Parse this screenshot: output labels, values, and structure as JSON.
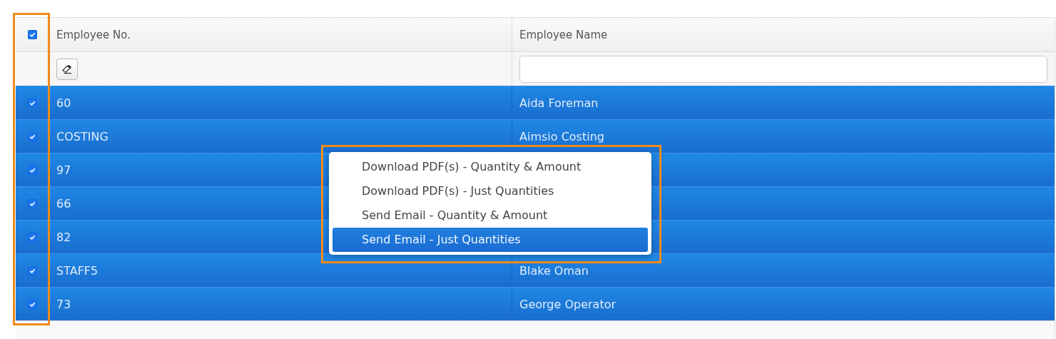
{
  "table": {
    "select_all": {
      "checked": true
    },
    "columns": [
      "Employee No.",
      "Employee Name"
    ],
    "rows": [
      {
        "number": "60",
        "name": "Aida Foreman",
        "checked": true,
        "selected": true
      },
      {
        "number": "COSTING",
        "name": "Aimsio Costing",
        "checked": true,
        "selected": true
      },
      {
        "number": "97",
        "checked": true,
        "selected": true
      },
      {
        "number": "66",
        "checked": true,
        "selected": true
      },
      {
        "number": "82",
        "checked": true,
        "selected": true
      },
      {
        "number": "STAFF5",
        "name": "Blake Oman",
        "checked": true,
        "selected": true
      },
      {
        "number": "73",
        "name": "George Operator",
        "checked": true,
        "selected": true
      }
    ]
  },
  "context_menu": {
    "items": [
      {
        "label": "Download PDF(s) - Quantity & Amount",
        "selected": false
      },
      {
        "label": "Download PDF(s) - Just Quantities",
        "selected": false
      },
      {
        "label": "Send Email - Quantity & Amount",
        "selected": false
      },
      {
        "label": "Send Email - Just Quantities",
        "selected": true
      }
    ]
  }
}
